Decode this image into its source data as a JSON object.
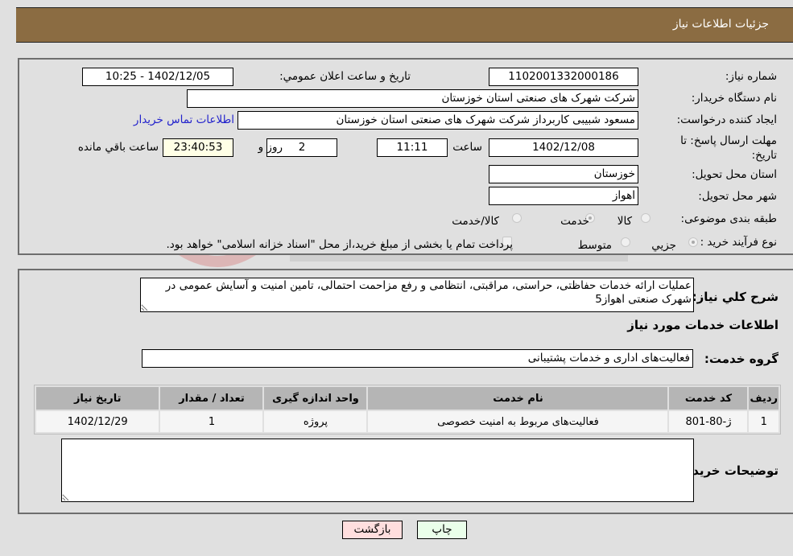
{
  "header": {
    "title": "جزئیات اطلاعات نیاز"
  },
  "details": {
    "need_number": {
      "label": "شماره نیاز:",
      "value": "1102001332000186"
    },
    "announce_datetime": {
      "label": "تاريخ و ساعت اعلان عمومي:",
      "value": "1402/12/05 - 10:25"
    },
    "buyer_org": {
      "label": "نام دستگاه خريدار:",
      "value": "شرکت شهرک های صنعتی استان خوزستان"
    },
    "requester": {
      "label": "ايجاد کننده درخواست:",
      "value": "مسعود شبیبی کاربرداز شرکت شهرک های صنعتی استان خوزستان"
    },
    "buyer_contact_link": "اطلاعات تماس خريدار",
    "deadline": {
      "label": "مهلت ارسال پاسخ: تا تاریخ:",
      "date": "1402/12/08",
      "time_label": "ساعت",
      "time": "11:11",
      "days": "2",
      "days_label": "روز و",
      "remaining": "23:40:53",
      "remaining_label": "ساعت باقي مانده"
    },
    "province": {
      "label": "استان محل تحويل:",
      "value": "خوزستان"
    },
    "city": {
      "label": "شهر محل تحويل:",
      "value": "اهواز"
    },
    "category": {
      "label": "طبقه بندی موضوعی:",
      "options": [
        "کالا",
        "خدمت",
        "کالا/خدمت"
      ],
      "selected": "خدمت"
    },
    "purchase_type": {
      "label": "نوع فرآيند خريد :",
      "options": [
        "جزيي",
        "متوسط"
      ],
      "selected": "جزيي",
      "treasury_note": "پرداخت تمام يا بخشی از مبلغ خريد،از محل \"اسناد خزانه اسلامی\" خواهد بود."
    }
  },
  "description": {
    "label": "شرح كلي نياز:",
    "value": "عملیات ارائه خدمات حفاظتی، حراستی، مراقبتی، انتظامی و رفع مزاحمت احتمالی، تامین امنیت و آسایش عمومی در شهرک صنعتی اهواز5"
  },
  "services": {
    "section_title": "اطلاعات خدمات مورد نياز",
    "group_label": "گروه خدمت:",
    "group_value": "فعالیت‌های اداری و خدمات پشتیبانی",
    "columns": [
      "رديف",
      "کد خدمت",
      "نام خدمت",
      "واحد اندازه گيری",
      "تعداد / مقدار",
      "تاريخ نياز"
    ],
    "rows": [
      [
        "1",
        "ژ-80-801",
        "فعالیت‌های مربوط به امنیت خصوصی",
        "پروژه",
        "1",
        "1402/12/29"
      ]
    ]
  },
  "buyer_notes": {
    "label": "توضيحات خريدار:",
    "value": ""
  },
  "buttons": {
    "print": "چاپ",
    "back": "بازگشت"
  },
  "colors": {
    "header_bg": "#8b6c42",
    "print_bg": "#eaffea",
    "back_bg": "#ffdede",
    "link": "#2222cc"
  }
}
